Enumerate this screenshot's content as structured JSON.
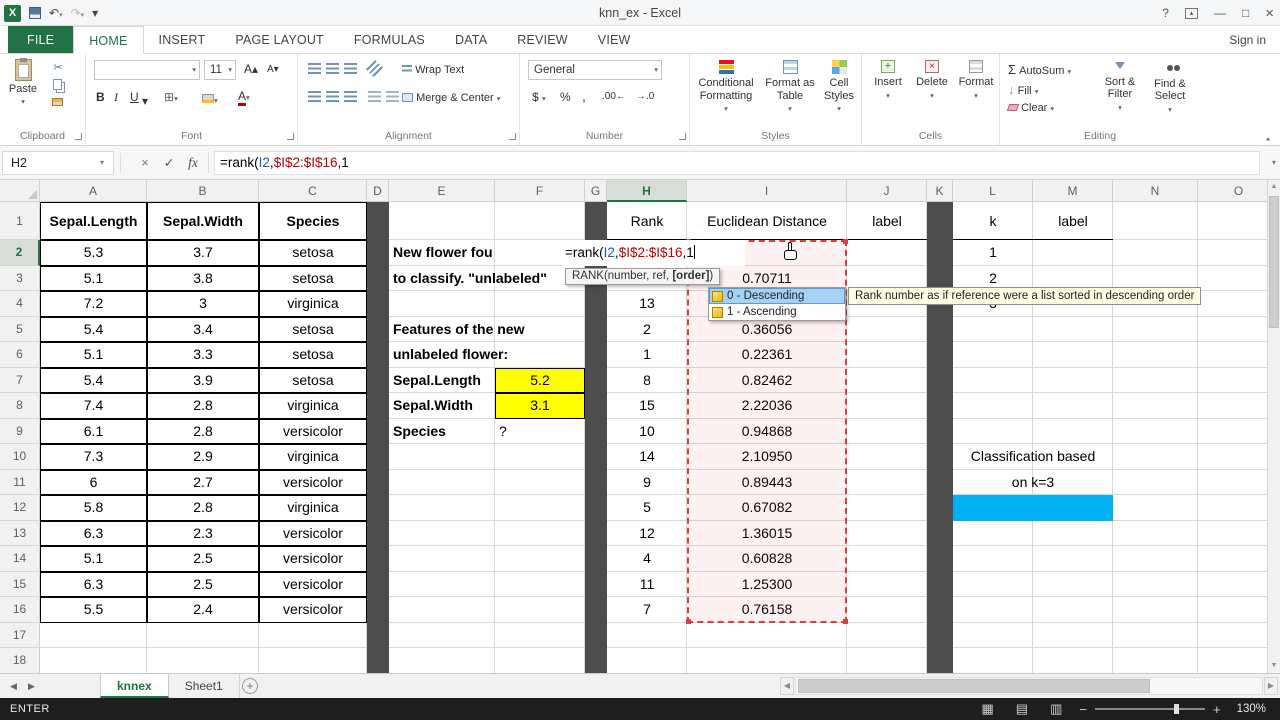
{
  "window": {
    "title": "knn_ex - Excel"
  },
  "colors": {
    "accent": "#217346",
    "yellow": "#ffff00",
    "blue_fill": "#00b0f0",
    "ref1": "#1a56c4",
    "ref2": "#c00000",
    "sel_red": "#e03e3e"
  },
  "ribbon": {
    "tabs": [
      "FILE",
      "HOME",
      "INSERT",
      "PAGE LAYOUT",
      "FORMULAS",
      "DATA",
      "REVIEW",
      "VIEW"
    ],
    "active_tab": "HOME",
    "sign_in": "Sign in",
    "groups": {
      "clipboard": {
        "title": "Clipboard",
        "paste": "Paste"
      },
      "font": {
        "title": "Font",
        "size": "11",
        "bold": "B",
        "italic": "I",
        "underline": "U"
      },
      "alignment": {
        "title": "Alignment",
        "wrap_text": "Wrap Text",
        "merge_center": "Merge & Center"
      },
      "number": {
        "title": "Number",
        "format": "General",
        "sym_currency": "$",
        "sym_percent": "%",
        "sym_comma": ",",
        "sym_inc": ".00",
        "sym_dec": ".0"
      },
      "styles": {
        "title": "Styles",
        "conditional": "Conditional Formatting",
        "format_table": "Format as Table",
        "cell_styles": "Cell Styles"
      },
      "cells": {
        "title": "Cells",
        "insert": "Insert",
        "delete": "Delete",
        "format": "Format"
      },
      "editing": {
        "title": "Editing",
        "autosum": "AutoSum",
        "fill": "Fill",
        "clear": "Clear",
        "sort": "Sort & Filter",
        "find": "Find & Select"
      }
    }
  },
  "formula_bar": {
    "name_box": "H2",
    "fx": "fx"
  },
  "formula": {
    "p1": "=rank(",
    "ref1": "I2",
    "c1": ",",
    "ref2": "$I$2:$I$16",
    "tail": ",1"
  },
  "sheet": {
    "active_col": "H",
    "active_row": 2,
    "col_headers": [
      "A",
      "B",
      "C",
      "D",
      "E",
      "F",
      "G",
      "H",
      "I",
      "J",
      "K",
      "L",
      "M",
      "N",
      "O"
    ],
    "row_count": 18,
    "cells": [
      {
        "a": "A1",
        "t": "Sepal.Length",
        "s": "b box"
      },
      {
        "a": "B1",
        "t": "Sepal.Width",
        "s": "b box"
      },
      {
        "a": "C1",
        "t": "Species",
        "s": "b box"
      },
      {
        "a": "H1",
        "t": "Rank",
        "s": "bb"
      },
      {
        "a": "I1",
        "t": "Euclidean Distance",
        "s": "bb"
      },
      {
        "a": "J1",
        "t": "label",
        "s": "bb"
      },
      {
        "a": "L1",
        "t": "k",
        "s": "bb"
      },
      {
        "a": "M1",
        "t": "label",
        "s": "bb"
      },
      {
        "a": "A2",
        "t": "5.3",
        "s": "box"
      },
      {
        "a": "B2",
        "t": "3.7",
        "s": "box"
      },
      {
        "a": "C2",
        "t": "setosa",
        "s": "box"
      },
      {
        "a": "A3",
        "t": "5.1",
        "s": "box"
      },
      {
        "a": "B3",
        "t": "3.8",
        "s": "box"
      },
      {
        "a": "C3",
        "t": "setosa",
        "s": "box"
      },
      {
        "a": "A4",
        "t": "7.2",
        "s": "box"
      },
      {
        "a": "B4",
        "t": "3",
        "s": "box"
      },
      {
        "a": "C4",
        "t": "virginica",
        "s": "box"
      },
      {
        "a": "A5",
        "t": "5.4",
        "s": "box"
      },
      {
        "a": "B5",
        "t": "3.4",
        "s": "box"
      },
      {
        "a": "C5",
        "t": "setosa",
        "s": "box"
      },
      {
        "a": "A6",
        "t": "5.1",
        "s": "box"
      },
      {
        "a": "B6",
        "t": "3.3",
        "s": "box"
      },
      {
        "a": "C6",
        "t": "setosa",
        "s": "box"
      },
      {
        "a": "A7",
        "t": "5.4",
        "s": "box"
      },
      {
        "a": "B7",
        "t": "3.9",
        "s": "box"
      },
      {
        "a": "C7",
        "t": "setosa",
        "s": "box"
      },
      {
        "a": "A8",
        "t": "7.4",
        "s": "box"
      },
      {
        "a": "B8",
        "t": "2.8",
        "s": "box"
      },
      {
        "a": "C8",
        "t": "virginica",
        "s": "box"
      },
      {
        "a": "A9",
        "t": "6.1",
        "s": "box"
      },
      {
        "a": "B9",
        "t": "2.8",
        "s": "box"
      },
      {
        "a": "C9",
        "t": "versicolor",
        "s": "box"
      },
      {
        "a": "A10",
        "t": "7.3",
        "s": "box"
      },
      {
        "a": "B10",
        "t": "2.9",
        "s": "box"
      },
      {
        "a": "C10",
        "t": "virginica",
        "s": "box"
      },
      {
        "a": "A11",
        "t": "6",
        "s": "box"
      },
      {
        "a": "B11",
        "t": "2.7",
        "s": "box"
      },
      {
        "a": "C11",
        "t": "versicolor",
        "s": "box"
      },
      {
        "a": "A12",
        "t": "5.8",
        "s": "box"
      },
      {
        "a": "B12",
        "t": "2.8",
        "s": "box"
      },
      {
        "a": "C12",
        "t": "virginica",
        "s": "box"
      },
      {
        "a": "A13",
        "t": "6.3",
        "s": "box"
      },
      {
        "a": "B13",
        "t": "2.3",
        "s": "box"
      },
      {
        "a": "C13",
        "t": "versicolor",
        "s": "box"
      },
      {
        "a": "A14",
        "t": "5.1",
        "s": "box"
      },
      {
        "a": "B14",
        "t": "2.5",
        "s": "box"
      },
      {
        "a": "C14",
        "t": "versicolor",
        "s": "box"
      },
      {
        "a": "A15",
        "t": "6.3",
        "s": "box"
      },
      {
        "a": "B15",
        "t": "2.5",
        "s": "box"
      },
      {
        "a": "C15",
        "t": "versicolor",
        "s": "box"
      },
      {
        "a": "A16",
        "t": "5.5",
        "s": "box"
      },
      {
        "a": "B16",
        "t": "2.4",
        "s": "box"
      },
      {
        "a": "C16",
        "t": "versicolor",
        "s": "box"
      },
      {
        "a": "E2",
        "t": "New flower fou",
        "s": "b left"
      },
      {
        "a": "E3",
        "t": "to classify. \"unlabeled\"",
        "s": "b left"
      },
      {
        "a": "E5",
        "t": "Features of the new",
        "s": "b left"
      },
      {
        "a": "E6",
        "t": "unlabeled flower:",
        "s": "b left"
      },
      {
        "a": "E7",
        "t": "Sepal.Length",
        "s": "b left"
      },
      {
        "a": "F7",
        "t": "5.2",
        "s": "box yellow"
      },
      {
        "a": "E8",
        "t": "Sepal.Width",
        "s": "b left"
      },
      {
        "a": "F8",
        "t": "3.1",
        "s": "box yellow"
      },
      {
        "a": "E9",
        "t": "Species",
        "s": "b left"
      },
      {
        "a": "F9",
        "t": "?",
        "s": "left"
      },
      {
        "a": "H4",
        "t": "13"
      },
      {
        "a": "H5",
        "t": "2"
      },
      {
        "a": "H6",
        "t": "1"
      },
      {
        "a": "H7",
        "t": "8"
      },
      {
        "a": "H8",
        "t": "15"
      },
      {
        "a": "H9",
        "t": "10"
      },
      {
        "a": "H10",
        "t": "14"
      },
      {
        "a": "H11",
        "t": "9"
      },
      {
        "a": "H12",
        "t": "5"
      },
      {
        "a": "H13",
        "t": "12"
      },
      {
        "a": "H14",
        "t": "4"
      },
      {
        "a": "H15",
        "t": "11"
      },
      {
        "a": "H16",
        "t": "7"
      },
      {
        "a": "I3",
        "t": "0.70711"
      },
      {
        "a": "I5",
        "t": "0.36056"
      },
      {
        "a": "I6",
        "t": "0.22361"
      },
      {
        "a": "I7",
        "t": "0.82462"
      },
      {
        "a": "I8",
        "t": "2.22036"
      },
      {
        "a": "I9",
        "t": "0.94868"
      },
      {
        "a": "I10",
        "t": "2.10950"
      },
      {
        "a": "I11",
        "t": "0.89443"
      },
      {
        "a": "I12",
        "t": "0.67082"
      },
      {
        "a": "I13",
        "t": "1.36015"
      },
      {
        "a": "I14",
        "t": "0.60828"
      },
      {
        "a": "I15",
        "t": "1.25300"
      },
      {
        "a": "I16",
        "t": "0.76158"
      },
      {
        "a": "L2",
        "t": "1"
      },
      {
        "a": "L3",
        "t": "2"
      },
      {
        "a": "L4",
        "t": "3"
      },
      {
        "a": "L10",
        "t": "Classification based",
        "s": "span2"
      },
      {
        "a": "L11",
        "t": "on k=3",
        "s": "span2"
      },
      {
        "a": "L12",
        "t": "",
        "s": "span2 blue"
      }
    ],
    "overlays": {
      "func_tooltip": {
        "prefix": "RANK(number, ref, ",
        "arg": "[order]",
        "suffix": ")"
      },
      "autocomplete": [
        {
          "label": "0 - Descending",
          "selected": true
        },
        {
          "label": "1 - Ascending",
          "selected": false
        }
      ],
      "arg_tooltip": "Rank number as if reference were a list sorted in descending order"
    }
  },
  "sheet_tabs": {
    "sheets": [
      {
        "name": "knnex",
        "active": true
      },
      {
        "name": "Sheet1",
        "active": false
      }
    ]
  },
  "statusbar": {
    "mode": "ENTER",
    "zoom": "130%"
  }
}
